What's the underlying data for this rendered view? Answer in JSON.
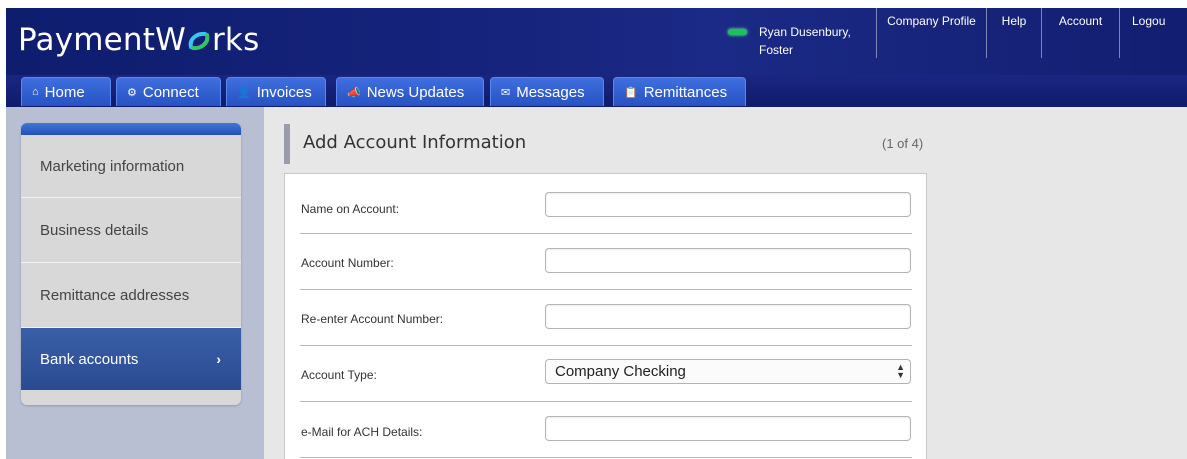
{
  "header": {
    "logo_text_left": "Payment",
    "logo_text_mid": "W",
    "logo_text_right": "rks",
    "user_name_line1": "Ryan Dusenbury,",
    "user_name_line2": "Foster",
    "links": [
      "Company Profile",
      "Help",
      "Account",
      "Logou"
    ]
  },
  "nav": {
    "tabs": [
      {
        "label": "Home",
        "icon": "home-icon",
        "glyph": "⌂"
      },
      {
        "label": "Connect",
        "icon": "gear-icon",
        "glyph": "⚙"
      },
      {
        "label": "Invoices",
        "icon": "person-icon",
        "glyph": "👤"
      },
      {
        "label": "News Updates",
        "icon": "megaphone-icon",
        "glyph": "📣"
      },
      {
        "label": "Messages",
        "icon": "envelope-icon",
        "glyph": "✉"
      },
      {
        "label": "Remittances",
        "icon": "clipboard-icon",
        "glyph": "📋"
      }
    ]
  },
  "sidebar": {
    "items": [
      {
        "label": "Marketing information"
      },
      {
        "label": "Business details"
      },
      {
        "label": "Remittance addresses"
      },
      {
        "label": "Bank accounts",
        "arrow": "›"
      }
    ]
  },
  "form": {
    "title": "Add Account Information",
    "step": "(1 of 4)",
    "fields": [
      {
        "label": "Name on Account:",
        "value": ""
      },
      {
        "label": "Account Number:",
        "value": ""
      },
      {
        "label": "Re-enter Account Number:",
        "value": ""
      },
      {
        "label": "Account Type:",
        "value": "Company Checking"
      },
      {
        "label": "e-Mail for ACH Details:",
        "value": ""
      }
    ]
  },
  "colors": {
    "header_bg": "#16237c",
    "tab_bg": "#2f5bcc",
    "sidebar_active": "#2f4f96",
    "status_green": "#1fbf5f"
  }
}
